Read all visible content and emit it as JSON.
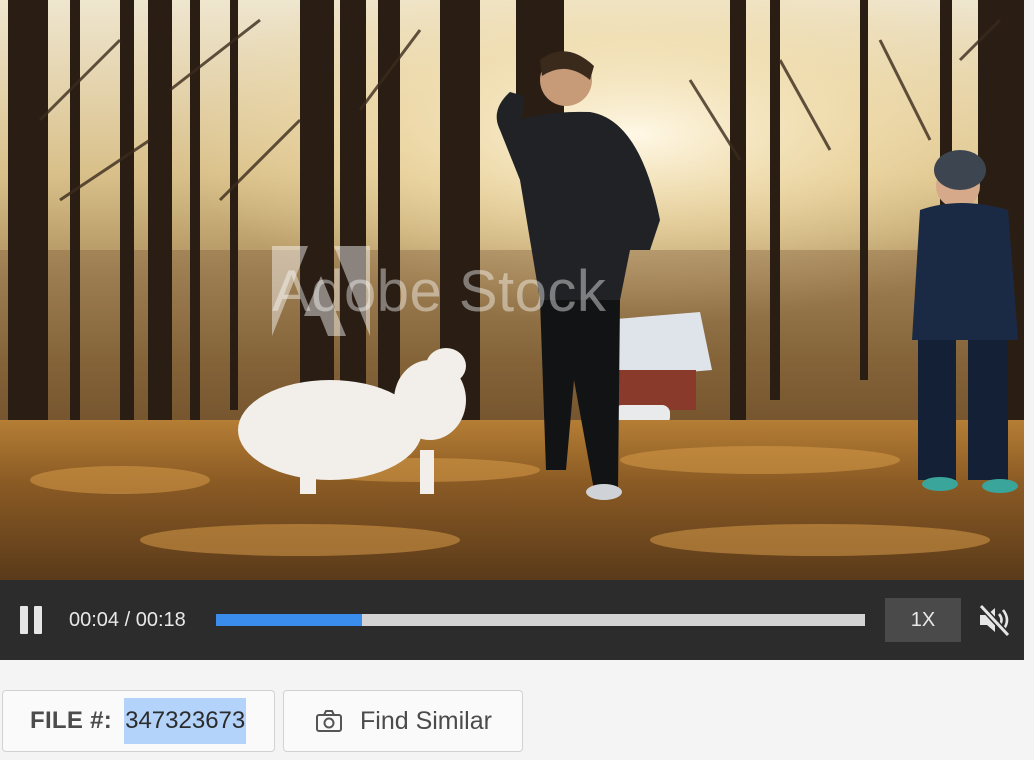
{
  "watermark": {
    "text": "Adobe Stock"
  },
  "player": {
    "time_display": "00:04 / 00:18",
    "progress": 0.225,
    "speed_label": "1X",
    "muted": true,
    "colors": {
      "bar": "#2c2c2c",
      "progress": "#3b8ded",
      "track": "#d4d4d4"
    }
  },
  "file": {
    "label": "FILE #:",
    "number": "347323673"
  },
  "actions": {
    "find_similar_label": "Find Similar"
  },
  "icons": {
    "pause": "pause-icon",
    "mute": "muted-speaker-icon",
    "camera": "camera-icon"
  }
}
